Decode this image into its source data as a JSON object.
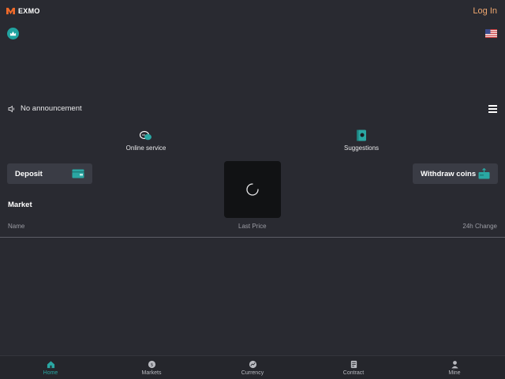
{
  "header": {
    "logo_text": "EXMO",
    "login_label": "Log In"
  },
  "announcement": {
    "text": "No announcement"
  },
  "quick_links": {
    "online_service": "Online service",
    "suggestions": "Suggestions"
  },
  "actions": {
    "deposit": "Deposit",
    "withdraw": "Withdraw coins"
  },
  "market": {
    "title": "Market",
    "columns": [
      "Name",
      "Last Price",
      "24h Change"
    ]
  },
  "nav": [
    {
      "label": "Home",
      "icon": "home-icon",
      "active": true
    },
    {
      "label": "Markets",
      "icon": "markets-icon",
      "active": false
    },
    {
      "label": "Currency",
      "icon": "currency-icon",
      "active": false
    },
    {
      "label": "Contract",
      "icon": "contract-icon",
      "active": false
    },
    {
      "label": "Mine",
      "icon": "user-icon",
      "active": false
    }
  ],
  "colors": {
    "background": "#292a31",
    "accent": "#2aa7a3",
    "login": "#f0a870",
    "button": "#3a3c45"
  }
}
